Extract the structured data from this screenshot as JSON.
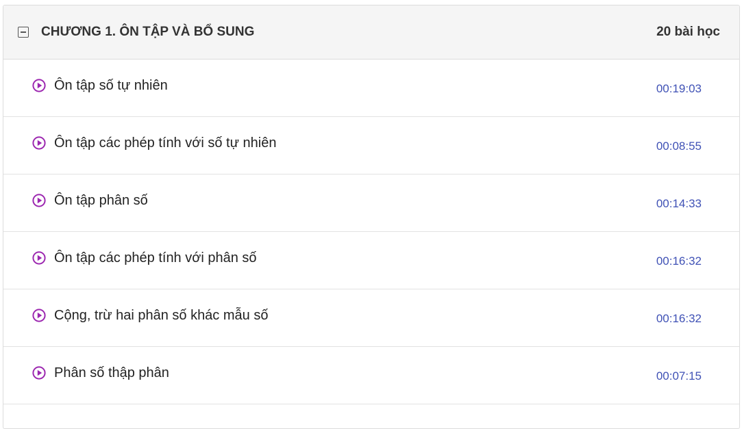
{
  "chapter": {
    "title": "CHƯƠNG 1. ÔN TẬP VÀ BỔ SUNG",
    "lesson_count": "20 bài học",
    "toggle_icon": "minus-square-icon"
  },
  "lessons": [
    {
      "title": "Ôn tập số tự nhiên",
      "duration": "00:19:03",
      "icon": "play-circle-icon"
    },
    {
      "title": "Ôn tập các phép tính với số tự nhiên",
      "duration": "00:08:55",
      "icon": "play-circle-icon"
    },
    {
      "title": "Ôn tập phân số",
      "duration": "00:14:33",
      "icon": "play-circle-icon"
    },
    {
      "title": "Ôn tập các phép tính với phân số",
      "duration": "00:16:32",
      "icon": "play-circle-icon"
    },
    {
      "title": "Cộng, trừ hai phân số khác mẫu số",
      "duration": "00:16:32",
      "icon": "play-circle-icon"
    },
    {
      "title": "Phân số thập phân",
      "duration": "00:07:15",
      "icon": "play-circle-icon"
    }
  ],
  "colors": {
    "play_icon": "#9c27b0",
    "duration": "#3f51b5",
    "header_bg": "#f5f5f5"
  }
}
